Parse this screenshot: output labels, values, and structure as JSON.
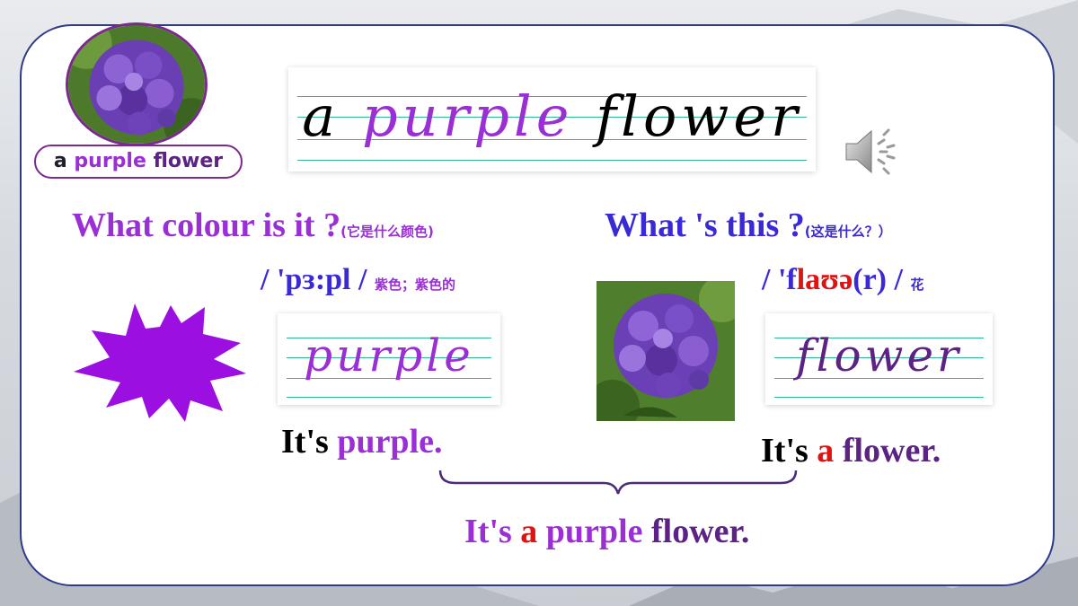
{
  "slide": {
    "pill_label": [
      "a",
      "purple",
      "flower"
    ],
    "main_board_words": [
      "a",
      "purple",
      "flower"
    ],
    "question_colour": {
      "text": "What colour is it ?",
      "note": "(它是什么颜色)"
    },
    "question_this": {
      "text": "What 's this ?",
      "note": "(这是什么？）"
    },
    "phonetic_purple": {
      "text": "/ 'pɜ:pl /",
      "meaning": "紫色；紫色的"
    },
    "phonetic_flower": {
      "pre": "/ 'f",
      "mid": "laʊə",
      "post": "(r) /",
      "meaning": "花"
    },
    "board_purple": "purple",
    "board_flower": "flower",
    "answer_purple": [
      "It's",
      "purple."
    ],
    "answer_flower": [
      "It's",
      "a",
      "flower."
    ],
    "answer_combined": [
      "It's",
      "a",
      "purple",
      "flower."
    ]
  },
  "icons": [
    "speaker-icon",
    "purple-star-shape",
    "flower-photo"
  ],
  "colors": {
    "purple": "#9b2fd6",
    "violet": "#5c2385",
    "red": "#e01212",
    "blue": "#3a2ad6",
    "line_green": "#2fb890",
    "card_border": "#2e3a8c"
  }
}
